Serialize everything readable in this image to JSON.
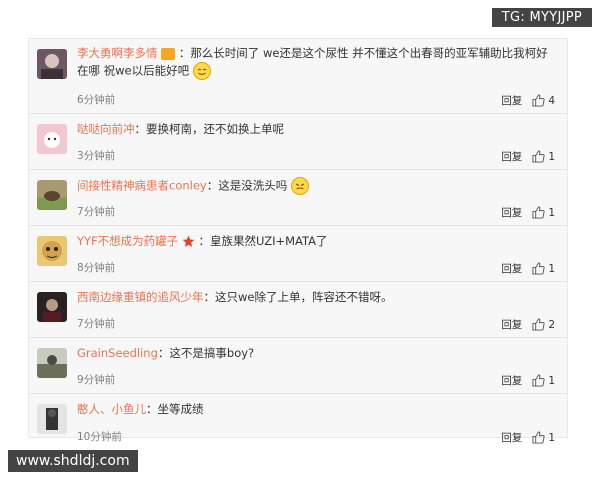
{
  "watermark": {
    "tg_label": "TG: MYYJJPP"
  },
  "footer": {
    "url": "www.shdldj.com"
  },
  "comments": [
    {
      "username": "李大勇啊李多情",
      "text": "那么长时间了 we还是这个尿性 并不懂这个出春哥的亚军辅助比我柯好在哪 祝we以后能好吧",
      "time": "6分钟前",
      "reply_label": "回复",
      "likes": "4",
      "avatar_color": "#5b4a5a",
      "badge_icon": "vip-badge-icon",
      "emoji": "smiling-emoji-icon"
    },
    {
      "username": "哒哒向前冲",
      "text": "要换柯南，还不如换上单呢",
      "time": "3分钟前",
      "reply_label": "回复",
      "likes": "1",
      "avatar_color": "#e9a0b0"
    },
    {
      "username": "间接性精神病患者conley",
      "text": "这是没洗头吗",
      "time": "7分钟前",
      "reply_label": "回复",
      "likes": "1",
      "avatar_color": "#8c7a52",
      "emoji": "disgusted-emoji-icon"
    },
    {
      "username": "YYF不想成为药罐子",
      "text": "皇族果然UZI+MATA了",
      "time": "8分钟前",
      "reply_label": "回复",
      "likes": "1",
      "avatar_color": "#caa14a",
      "badge_icon": "star-badge-icon"
    },
    {
      "username": "西南边缘重镇的追风少年",
      "text": "这只we除了上单，阵容还不错呀。",
      "time": "7分钟前",
      "reply_label": "回复",
      "likes": "2",
      "avatar_color": "#3a3030"
    },
    {
      "username": "GrainSeedling",
      "text": "这不是搞事boy?",
      "time": "9分钟前",
      "reply_label": "回复",
      "likes": "1",
      "avatar_color": "#7a7f6a"
    },
    {
      "username": "憨人、小鱼儿",
      "text": "坐等成绩",
      "time": "10分钟前",
      "reply_label": "回复",
      "likes": "1",
      "avatar_color": "#4a4a4a"
    }
  ],
  "colors": {
    "username": "#eb7350",
    "text": "#333333",
    "time": "#808080",
    "background": "#f7f7f7"
  }
}
